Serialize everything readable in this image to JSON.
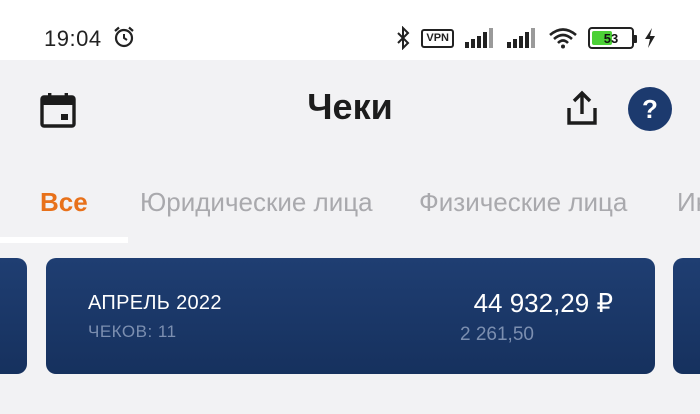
{
  "status_bar": {
    "time": "19:04",
    "vpn_label": "VPN",
    "battery": "53",
    "battery_level": 0.53,
    "icons": [
      "alarm-icon",
      "bluetooth-icon",
      "vpn-icon",
      "signal-icon",
      "signal-icon",
      "wifi-icon",
      "battery-icon",
      "charging-icon"
    ]
  },
  "header": {
    "title": "Чеки",
    "left_icon": "calendar-icon",
    "right_icons": [
      "share-icon",
      "help-icon"
    ],
    "help_label": "?"
  },
  "tabs": [
    {
      "label": "Все",
      "active": true
    },
    {
      "label": "Юридические лица",
      "active": false
    },
    {
      "label": "Физические лица",
      "active": false
    },
    {
      "label": "Ин",
      "active": false
    }
  ],
  "card": {
    "month": "АПРЕЛЬ 2022",
    "count": "ЧЕКОВ: 11",
    "amount": "44 932,29 ₽",
    "sub_amount": "2 261,50"
  },
  "colors": {
    "accent": "#e8711a",
    "card_bg": "#1c3a6e",
    "help_bg": "#1c3a6e",
    "inactive_tab": "#a9a9ad",
    "battery_fill": "#4cd137"
  }
}
